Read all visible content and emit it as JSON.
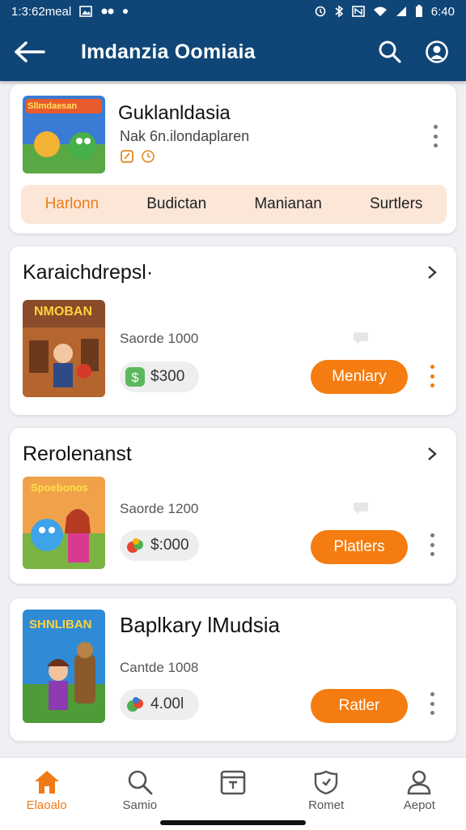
{
  "status_bar": {
    "time_left": "1:3:62meal",
    "time_right": "6:40"
  },
  "app_bar": {
    "title": "Imdanzia Oomiaia"
  },
  "header_card": {
    "name": "Guklanldasia",
    "subtitle": "Nak 6n.ilondaplaren",
    "thumb_caption": "Sllmdaesan",
    "tabs": [
      {
        "label": "Harlonn",
        "active": true
      },
      {
        "label": "Budictan",
        "active": false
      },
      {
        "label": "Manianan",
        "active": false
      },
      {
        "label": "Surtlers",
        "active": false
      }
    ]
  },
  "items": [
    {
      "section_title": "Karaichdrepsl·",
      "thumb_caption": "NMOBAN",
      "subtitle": "Saorde 1000",
      "price": "$300",
      "button": "Menlary",
      "kebab_color": "orange"
    },
    {
      "section_title": "Rerolenanst",
      "thumb_caption": "Spoebonos",
      "subtitle": "Saorde 1200",
      "price": "$:000",
      "button": "Platlers",
      "kebab_color": "gray"
    },
    {
      "section_title": "Baplkary lMudsia",
      "thumb_caption": "SHNLIBAN",
      "subtitle": "Cantde 1008",
      "price": "4.00l",
      "button": "Ratler",
      "kebab_color": "gray"
    }
  ],
  "bottom_nav": [
    {
      "label": "Elaoalo",
      "icon": "home-icon",
      "active": true
    },
    {
      "label": "Samio",
      "icon": "search-icon",
      "active": false
    },
    {
      "label": "",
      "icon": "calendar-icon",
      "active": false
    },
    {
      "label": "Romet",
      "icon": "shield-icon",
      "active": false
    },
    {
      "label": "Aepot",
      "icon": "user-icon",
      "active": false
    }
  ],
  "colors": {
    "app_bar": "#0f4677",
    "accent": "#f57c10",
    "tabs_bg": "#fbe6d8",
    "background": "#eef0f3"
  }
}
